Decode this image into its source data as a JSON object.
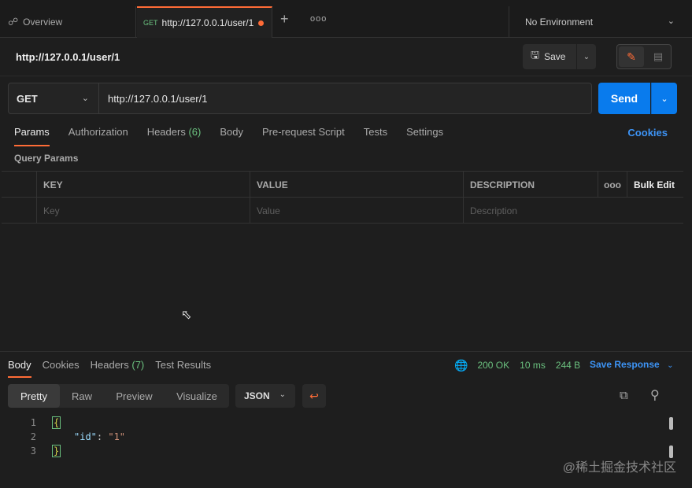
{
  "tabs": {
    "overview_label": "Overview",
    "active_method": "GET",
    "active_url": "http://127.0.0.1/user/1",
    "plus": "+",
    "more": "ooo"
  },
  "environment": {
    "label": "No Environment"
  },
  "request": {
    "title": "http://127.0.0.1/user/1",
    "save_label": "Save",
    "method": "GET",
    "url": "http://127.0.0.1/user/1",
    "send_label": "Send"
  },
  "request_tabs": {
    "params": "Params",
    "authorization": "Authorization",
    "headers": "Headers",
    "headers_count": "(6)",
    "body": "Body",
    "prerequest": "Pre-request Script",
    "tests": "Tests",
    "settings": "Settings",
    "cookies": "Cookies"
  },
  "query_params": {
    "label": "Query Params",
    "columns": {
      "key": "KEY",
      "value": "VALUE",
      "description": "DESCRIPTION",
      "more": "ooo",
      "bulk_edit": "Bulk Edit"
    },
    "placeholders": {
      "key": "Key",
      "value": "Value",
      "description": "Description"
    }
  },
  "response": {
    "tabs": {
      "body": "Body",
      "cookies": "Cookies",
      "headers": "Headers",
      "headers_count": "(7)",
      "test_results": "Test Results"
    },
    "status": "200 OK",
    "time": "10 ms",
    "size": "244 B",
    "save_response": "Save Response",
    "views": {
      "pretty": "Pretty",
      "raw": "Raw",
      "preview": "Preview",
      "visualize": "Visualize"
    },
    "format": "JSON",
    "lines": [
      {
        "num": "1"
      },
      {
        "num": "2",
        "key": "\"id\"",
        "sep": ": ",
        "value": "\"1\""
      },
      {
        "num": "3"
      }
    ],
    "open_brace": "{",
    "close_brace": "}"
  },
  "watermark": "@稀土掘金技术社区",
  "icons": {
    "overview": "overview-icon",
    "save": "save-icon",
    "edit": "pencil-icon",
    "docs": "docs-icon",
    "globe": "globe-icon",
    "wrap": "wrap-lines-icon",
    "copy": "copy-icon",
    "search": "search-icon"
  },
  "colors": {
    "accent": "#ff6c37",
    "primary": "#097bed",
    "success": "#6bc17f",
    "link": "#3d94f6"
  }
}
